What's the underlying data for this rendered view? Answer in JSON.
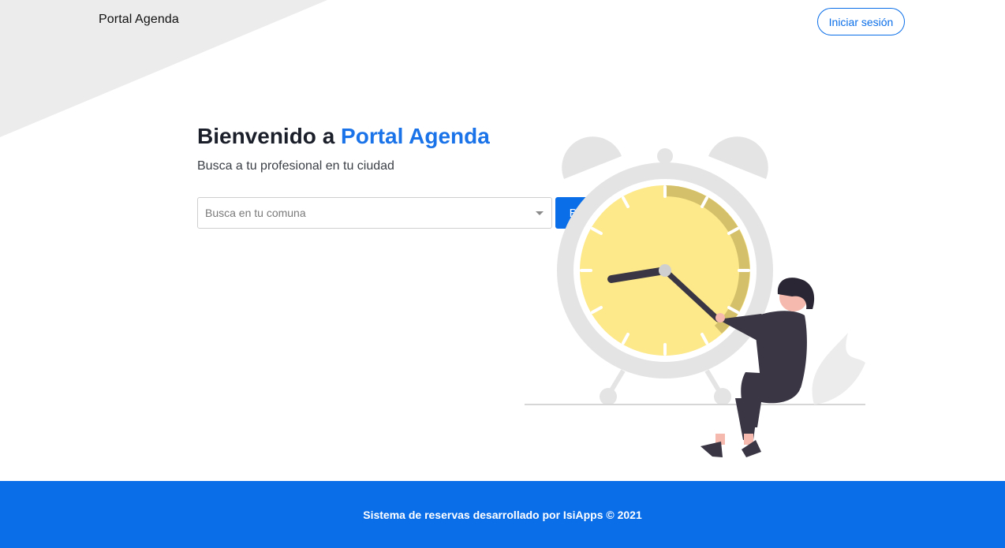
{
  "header": {
    "brand": "Portal Agenda",
    "login_label": "Iniciar sesión"
  },
  "hero": {
    "title_prefix": "Bienvenido a ",
    "title_accent": "Portal Agenda",
    "subtitle": "Busca a tu profesional en tu ciudad"
  },
  "search": {
    "placeholder": "Busca en tu comuna",
    "button_label": "Buscar"
  },
  "footer": {
    "text": "Sistema de reservas desarrollado por IsiApps © 2021"
  },
  "colors": {
    "primary": "#0a6ee8",
    "accent_text": "#1a73e8",
    "clock_face": "#fde98a",
    "clock_shade": "#d4c06a",
    "figure_dark": "#3a3644"
  },
  "icons": {
    "select_caret": "chevron-down-icon",
    "illustration": "alarm-clock-woman-illustration"
  }
}
